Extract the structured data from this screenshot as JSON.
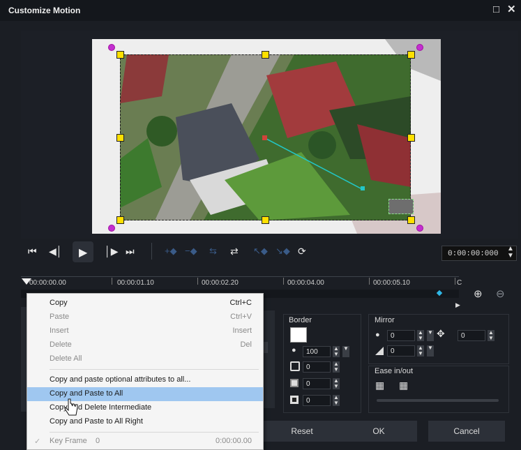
{
  "window": {
    "title": "Customize Motion",
    "maximize_icon": "maximize-icon",
    "close_icon": "close-icon"
  },
  "colors": {
    "handle": "#ffe000",
    "corner": "#c32fd0",
    "path": "#22c7c7",
    "menu_highlight": "#9fc7f0",
    "bg": "#1b1e24"
  },
  "playback": {
    "timecode": "0:00:00:000"
  },
  "timeline": {
    "ticks": [
      "00:00:00.00",
      "00:00:01.10",
      "00:00:02.20",
      "00:00:04.00",
      "00:00:05.10",
      "C"
    ]
  },
  "context_menu": {
    "items": [
      {
        "label": "Copy",
        "shortcut": "Ctrl+C",
        "enabled": true
      },
      {
        "label": "Paste",
        "shortcut": "Ctrl+V",
        "enabled": false
      },
      {
        "label": "Insert",
        "shortcut": "Insert",
        "enabled": false
      },
      {
        "label": "Delete",
        "shortcut": "Del",
        "enabled": false
      },
      {
        "label": "Delete All",
        "shortcut": "",
        "enabled": false
      },
      {
        "label": "Copy and paste optional attributes to all...",
        "shortcut": "",
        "enabled": true
      },
      {
        "label": "Copy and Paste to All",
        "shortcut": "",
        "enabled": true,
        "highlighted": true
      },
      {
        "label": "Copy and Delete Intermediate",
        "shortcut": "",
        "enabled": true
      },
      {
        "label": "Copy and Paste to All Right",
        "shortcut": "",
        "enabled": true
      }
    ],
    "footer": {
      "label": "Key Frame",
      "value": "0",
      "time": "0:00:00.00"
    }
  },
  "border": {
    "label": "Border",
    "opacity": "100",
    "field1": "0",
    "field2": "0",
    "field3": "0"
  },
  "mirror": {
    "label": "Mirror",
    "value1": "0",
    "value2": "0",
    "value3": "0"
  },
  "ease": {
    "label": "Ease in/out"
  },
  "buttons": {
    "reset": "Reset",
    "ok": "OK",
    "cancel": "Cancel"
  }
}
